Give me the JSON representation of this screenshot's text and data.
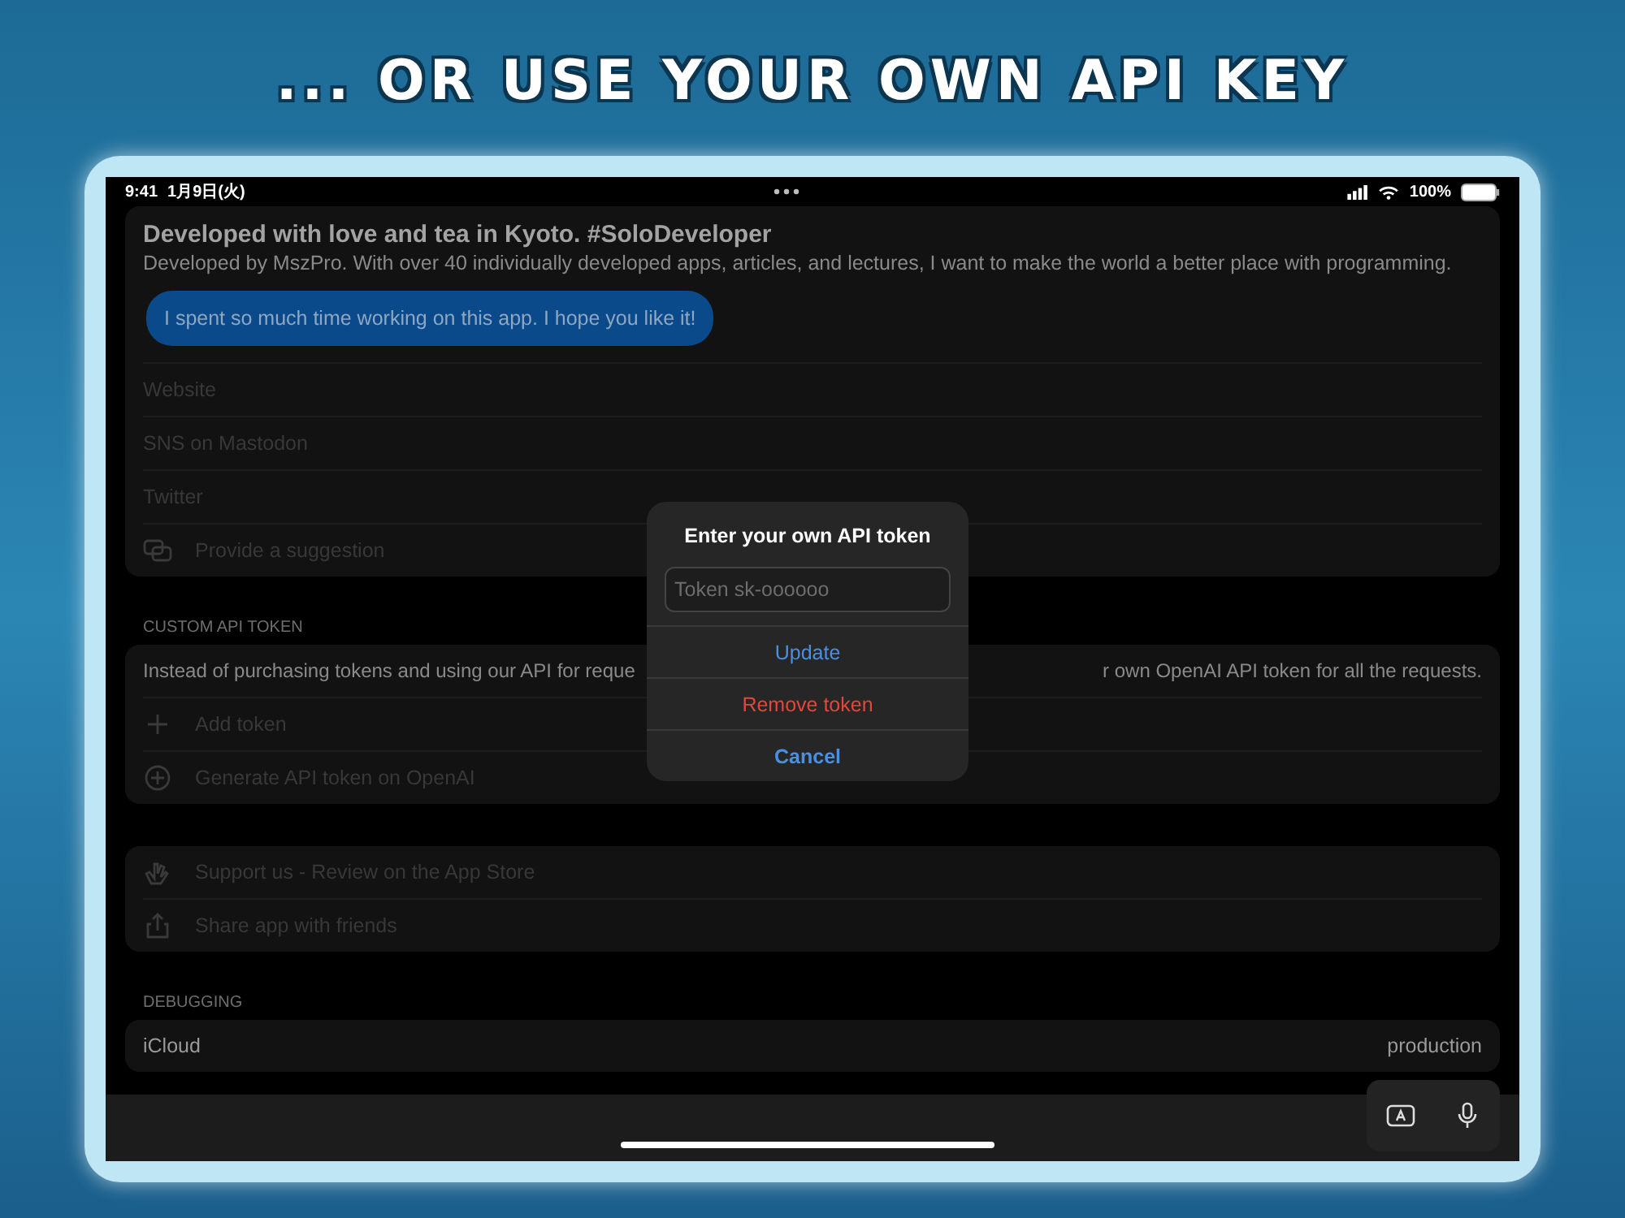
{
  "headline": "... OR USE YOUR OWN API KEY",
  "status_bar": {
    "time": "9:41",
    "date": "1月9日(火)",
    "battery": "100%"
  },
  "about": {
    "title": "Developed with love and tea in Kyoto. #SoloDeveloper",
    "subtitle": "Developed by MszPro. With over 40 individually developed apps, articles, and lectures, I want to make the world a better place with programming.",
    "bubble": "I spent so much time working on this app. I hope you like it!",
    "rows": [
      {
        "label": "Website",
        "kind": "link"
      },
      {
        "label": "SNS on Mastodon",
        "kind": "link"
      },
      {
        "label": "Twitter",
        "kind": "link"
      },
      {
        "label": "Provide a suggestion",
        "kind": "suggestion"
      }
    ]
  },
  "custom_token": {
    "header": "CUSTOM API TOKEN",
    "text_left": "Instead of purchasing tokens and using our API for reque",
    "text_right": "r own OpenAI API token for all the requests.",
    "rows": [
      {
        "label": "Add token",
        "kind": "add"
      },
      {
        "label": "Generate API token on OpenAI",
        "kind": "generate"
      }
    ]
  },
  "support": {
    "rows": [
      {
        "label": "Support us - Review on the App Store",
        "kind": "review"
      },
      {
        "label": "Share app with friends",
        "kind": "share"
      }
    ]
  },
  "debugging": {
    "header": "DEBUGGING",
    "label": "iCloud",
    "value": "production"
  },
  "dialog": {
    "title": "Enter your own API token",
    "placeholder": "Token sk-oooooo",
    "actions": [
      {
        "label": "Update",
        "kind": "default"
      },
      {
        "label": "Remove token",
        "kind": "destructive"
      },
      {
        "label": "Cancel",
        "kind": "cancel"
      }
    ]
  }
}
